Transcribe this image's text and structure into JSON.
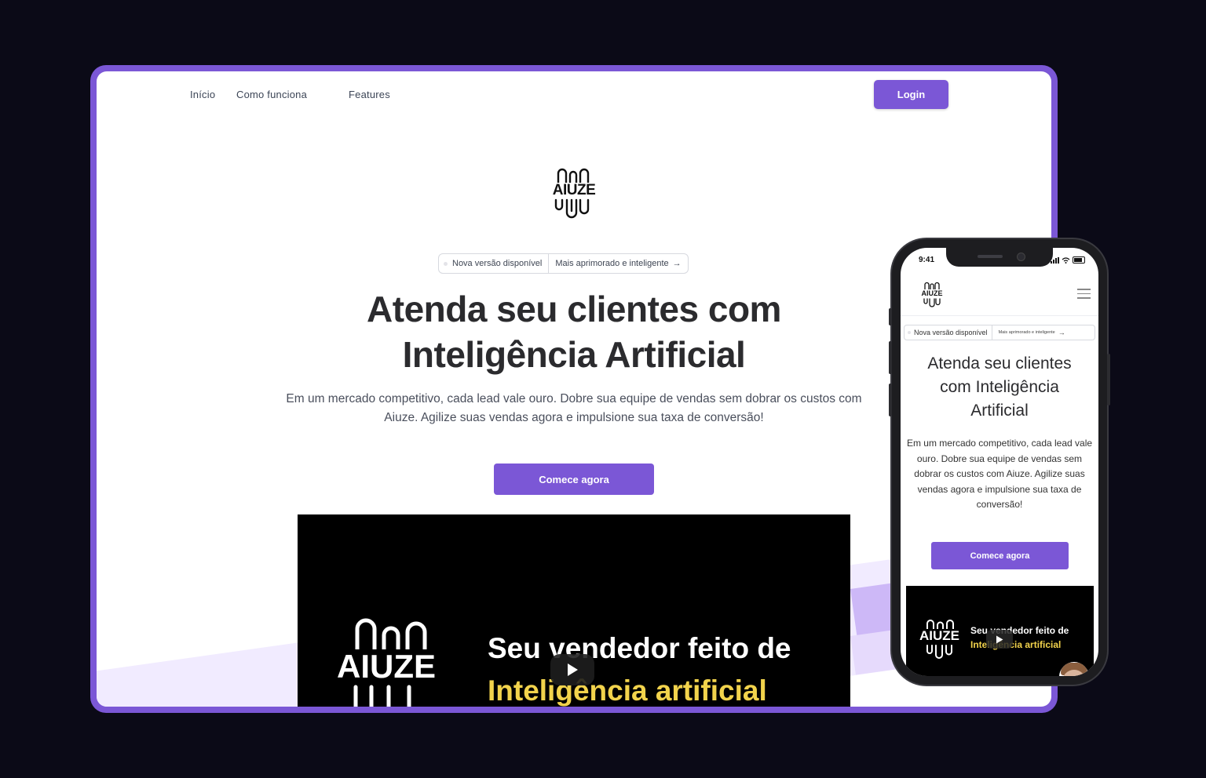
{
  "desktop": {
    "nav": {
      "links": [
        "Início",
        "Como funciona",
        "Features"
      ],
      "login_label": "Login"
    },
    "logo_text": "AIUZE",
    "pill": {
      "left": "Nova versão disponível",
      "right": "Mais aprimorado e inteligente",
      "arrow": "→"
    },
    "hero": {
      "title_line1": "Atenda seu clientes com",
      "title_line2": "Inteligência Artificial",
      "subtitle": "Em um mercado competitivo, cada lead vale ouro. Dobre sua equipe de vendas sem dobrar os custos com Aiuze. Agilize suas vendas agora e impulsione sua taxa de conversão!",
      "cta_label": "Comece agora"
    },
    "video": {
      "logo_text": "AIUZE",
      "line1": "Seu vendedor feito de",
      "line2": "Inteligência artificial"
    }
  },
  "mobile": {
    "status_time": "9:41",
    "logo_text": "AIUZE",
    "pill": {
      "left": "Nova versão disponível",
      "right": "Mais aprimorado e inteligente",
      "arrow": "→"
    },
    "hero": {
      "title_line1": "Atenda seu clientes",
      "title_line2": "com Inteligência",
      "title_line3": "Artificial",
      "subtitle": "Em um mercado competitivo, cada lead vale ouro. Dobre sua equipe de vendas sem dobrar os custos com Aiuze. Agilize suas vendas agora e impulsione sua taxa de conversão!",
      "cta_label": "Comece agora"
    },
    "video": {
      "logo_text": "AIUZE",
      "line1": "Seu vendedor feito de",
      "line2": "Inteligência artificial"
    }
  },
  "colors": {
    "accent": "#7b57d6",
    "background": "#0b0a17",
    "highlight_yellow": "#f2d34c"
  }
}
